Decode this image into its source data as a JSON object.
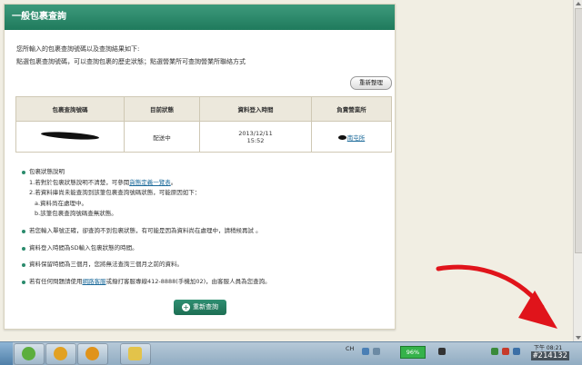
{
  "panel": {
    "title": "一般包裹查詢",
    "intro_line1": "您所輸入的包裹查詢號碼以及查詢結果如下:",
    "intro_line2": "點選包裹查詢號碼，可以查詢包裹的歷史狀態；點選營業所可查詢營業所聯絡方式",
    "reset_button": "重新整理"
  },
  "table": {
    "headers": [
      "包裹查詢號碼",
      "目前狀態",
      "資料登入時間",
      "負責營業所"
    ],
    "row": {
      "status": "配送中",
      "date": "2013/12/11",
      "time": "15:52",
      "office_link": "南屯所"
    }
  },
  "notes": {
    "status_title": "包裹狀態說明",
    "status_1a": "1.若對於包裹狀態說明不清楚，可參閱",
    "status_1_link": "貨態定義一覽表",
    "status_1b": "。",
    "status_2": "2.若資料庫尚未能查詢到該筆包裹查詢號碼狀態，可能原因如下：",
    "status_2a": "a.資料尚在處理中。",
    "status_2b": "b.該筆包裹查詢號碼查無狀態。",
    "note_2": "若您輸入單號正確，卻查詢不到包裹狀態，有可能是因為資料尚在處理中，請稍候再試 。",
    "note_3": "資料登入時間為SD輸入包裹狀態的時間。",
    "note_4": "資料保留時間為三個月，您將無法查詢三個月之前的資料。",
    "note_5a": "若有任何問題請使用",
    "note_5_link": "網路客服",
    "note_5b": "或撥打客服專線412-8888(手機加02)，由客服人員為您查詢。"
  },
  "requery_button": "重新查詢",
  "taskbar": {
    "ime": "CH",
    "battery": "96%",
    "clock_period": "下午 08:21"
  },
  "watermark": "#214132",
  "colors": {
    "header_green": "#2a8b6c",
    "button_green": "#1d6e53",
    "annotation_red": "#e0141b",
    "link_blue": "#1c6a9a"
  }
}
